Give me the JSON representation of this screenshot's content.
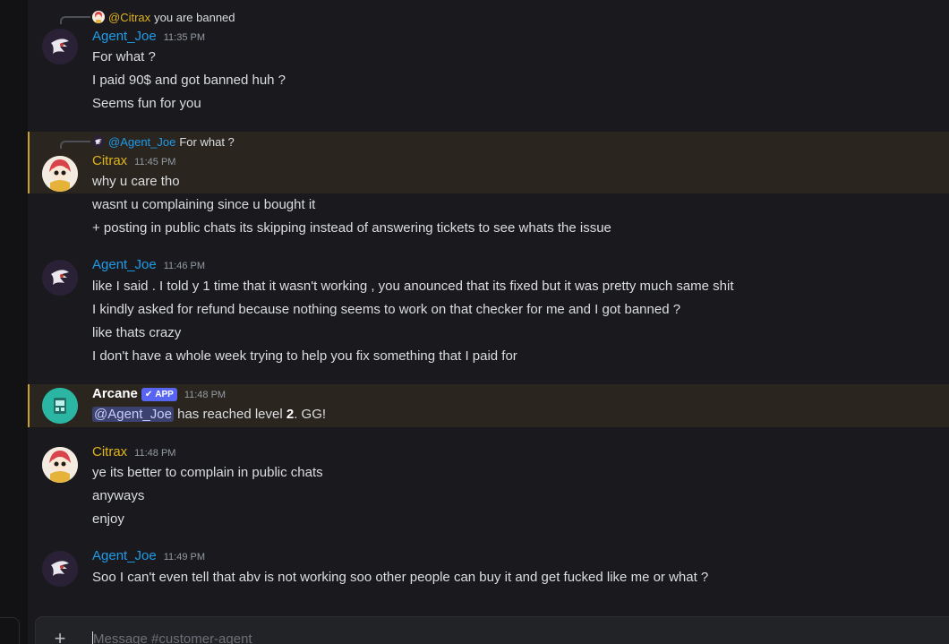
{
  "composer": {
    "placeholder": "Message #customer-agent",
    "plus_icon": "+"
  },
  "messages": [
    {
      "reply": {
        "name": "@Citrax",
        "text": "you are banned"
      },
      "author": "Agent_Joe",
      "time": "11:35 PM",
      "lines": [
        "For what ?",
        "I paid 90$ and got banned huh ?",
        "Seems fun for you"
      ]
    },
    {
      "reply": {
        "name": "@Agent_Joe",
        "text": "For what ?"
      },
      "author": "Citrax",
      "time": "11:45 PM",
      "lines": [
        "why u care tho",
        "wasnt u complaining since u bought it",
        "+ posting in public chats its skipping instead of answering tickets to see whats the issue"
      ]
    },
    {
      "author": "Agent_Joe",
      "time": "11:46 PM",
      "lines": [
        "like I said . I told y 1 time that it wasn't working , you anounced that its fixed but it was pretty much same shit",
        "I kindly asked for refund because nothing seems to work on that checker for me and I got banned ?",
        "like thats crazy",
        "I don't have a whole week trying to help you fix something that I paid for"
      ]
    },
    {
      "author": "Arcane",
      "badge": "APP",
      "time": "11:48 PM",
      "level_msg": {
        "mention": "@Agent_Joe",
        "pre": " has reached level ",
        "level": "2",
        "post": ". GG!"
      }
    },
    {
      "author": "Citrax",
      "time": "11:48 PM",
      "lines": [
        "ye its better to complain in public chats",
        "anyways",
        "enjoy"
      ]
    },
    {
      "author": "Agent_Joe",
      "time": "11:49 PM",
      "lines": [
        "Soo I can't even tell that abv is not working soo other people can buy it and get fucked like me or what ?"
      ]
    }
  ],
  "colors": {
    "agent": "#1e9be9",
    "citrax": "#e0b41c",
    "highlight_border": "#c9a227",
    "app_badge": "#5865f2"
  }
}
